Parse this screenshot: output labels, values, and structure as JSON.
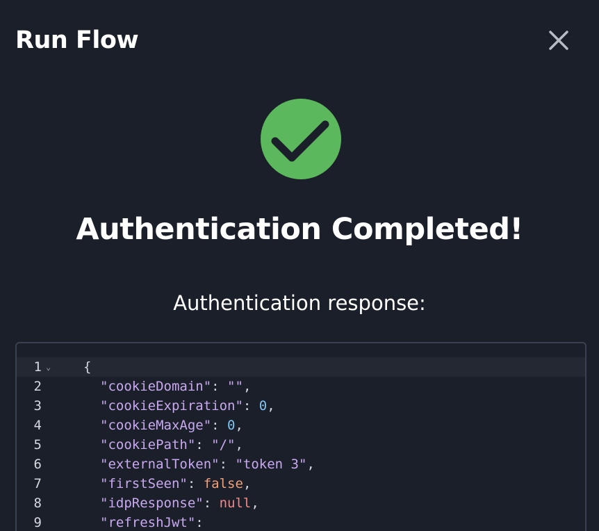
{
  "modal": {
    "title": "Run Flow",
    "close_icon": "close-icon"
  },
  "status": {
    "icon": "check-circle-icon",
    "icon_color": "#5cb85c",
    "headline": "Authentication Completed!",
    "subheadline": "Authentication response:"
  },
  "editor": {
    "lines": [
      {
        "num": "1",
        "fold": "⌄",
        "brace": "{"
      },
      {
        "num": "2",
        "key": "\"cookieDomain\"",
        "sep": ": ",
        "value": "\"\"",
        "value_type": "str",
        "tail": ","
      },
      {
        "num": "3",
        "key": "\"cookieExpiration\"",
        "sep": ": ",
        "value": "0",
        "value_type": "num",
        "tail": ","
      },
      {
        "num": "4",
        "key": "\"cookieMaxAge\"",
        "sep": ": ",
        "value": "0",
        "value_type": "num",
        "tail": ","
      },
      {
        "num": "5",
        "key": "\"cookiePath\"",
        "sep": ": ",
        "value": "\"/\"",
        "value_type": "str",
        "tail": ","
      },
      {
        "num": "6",
        "key": "\"externalToken\"",
        "sep": ": ",
        "value": "\"token 3\"",
        "value_type": "str",
        "tail": ","
      },
      {
        "num": "7",
        "key": "\"firstSeen\"",
        "sep": ": ",
        "value": "false",
        "value_type": "bool",
        "tail": ","
      },
      {
        "num": "8",
        "key": "\"idpResponse\"",
        "sep": ": ",
        "value": "null",
        "value_type": "null",
        "tail": ","
      },
      {
        "num": "9",
        "key": "\"refreshJwt\"",
        "sep": ":",
        "value": "",
        "value_type": "str",
        "tail": ""
      }
    ]
  }
}
